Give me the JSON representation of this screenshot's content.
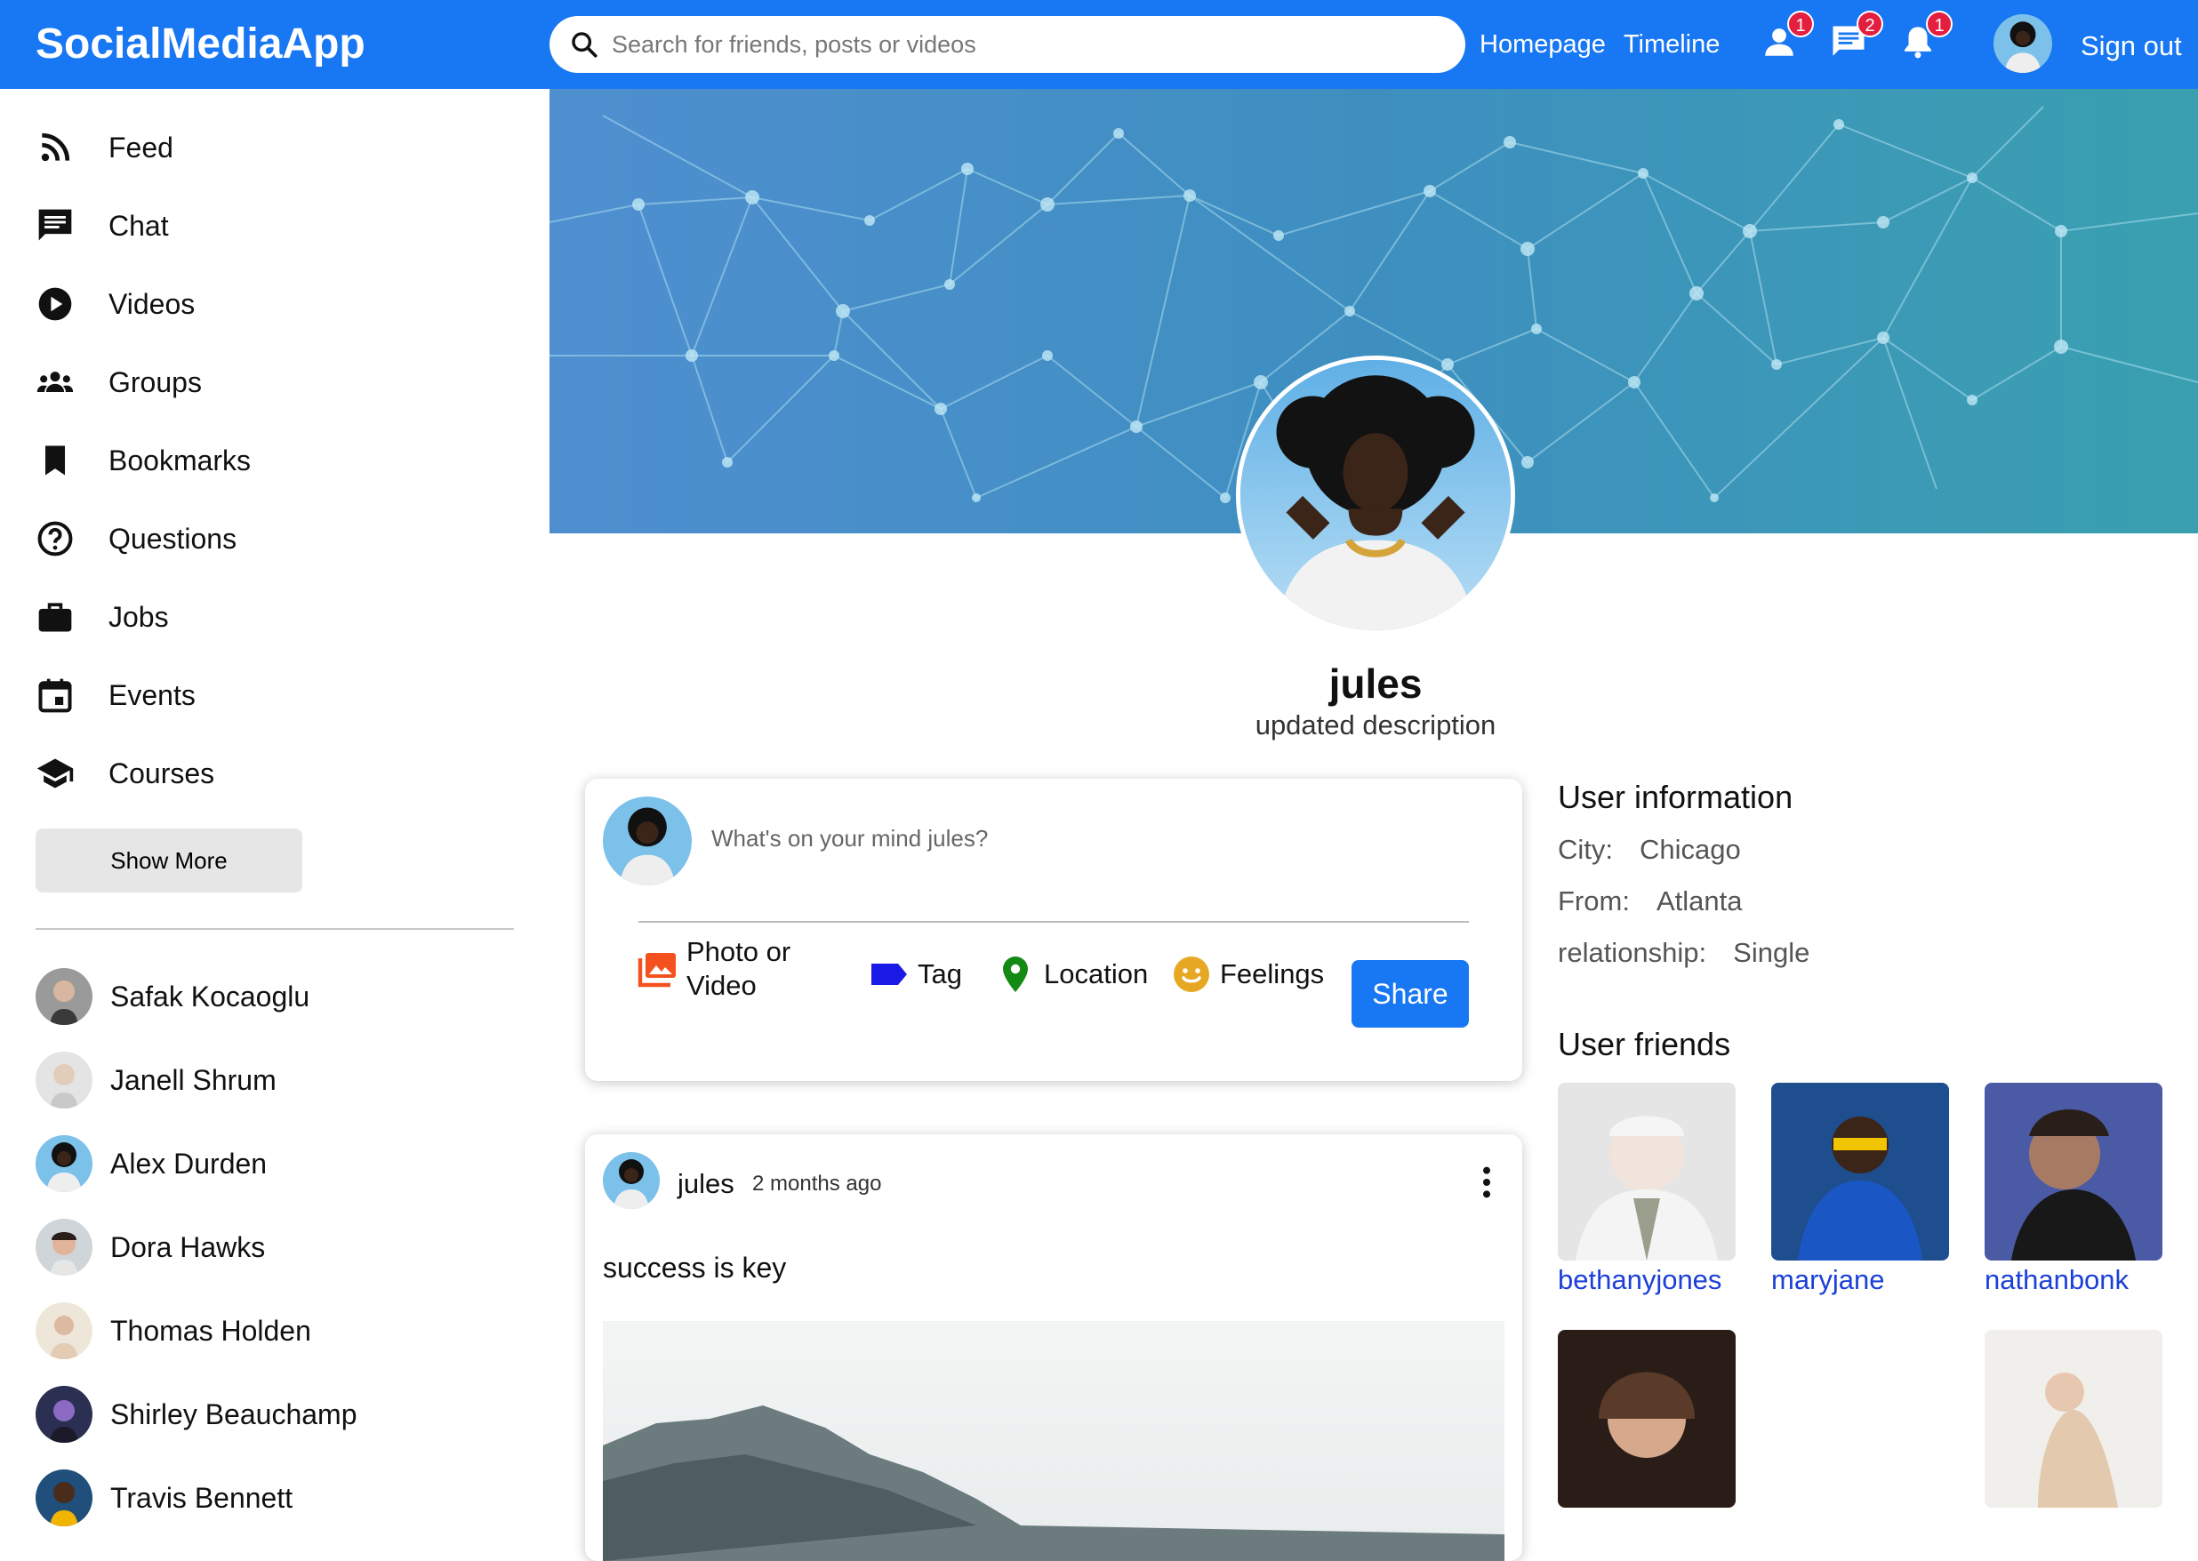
{
  "app": {
    "logo": "SocialMediaApp"
  },
  "topbar": {
    "search_placeholder": "Search for friends, posts or videos",
    "links": [
      "Homepage",
      "Timeline"
    ],
    "badges": {
      "friend_requests": "1",
      "messages": "2",
      "notifications": "1"
    },
    "sign_out": "Sign out"
  },
  "sidebar": {
    "items": [
      {
        "label": "Feed",
        "icon": "rss-feed-icon"
      },
      {
        "label": "Chat",
        "icon": "chat-icon"
      },
      {
        "label": "Videos",
        "icon": "play-circle-icon"
      },
      {
        "label": "Groups",
        "icon": "groups-icon"
      },
      {
        "label": "Bookmarks",
        "icon": "bookmark-icon"
      },
      {
        "label": "Questions",
        "icon": "help-circle-icon"
      },
      {
        "label": "Jobs",
        "icon": "briefcase-icon"
      },
      {
        "label": "Events",
        "icon": "calendar-icon"
      },
      {
        "label": "Courses",
        "icon": "school-icon"
      }
    ],
    "show_more": "Show More",
    "friends": [
      "Safak Kocaoglu",
      "Janell Shrum",
      "Alex Durden",
      "Dora Hawks",
      "Thomas Holden",
      "Shirley Beauchamp",
      "Travis Bennett"
    ]
  },
  "profile": {
    "name": "jules",
    "description": "updated description"
  },
  "share": {
    "placeholder": "What's on your mind jules?",
    "options": [
      "Photo or Video",
      "Tag",
      "Location",
      "Feelings"
    ],
    "button": "Share"
  },
  "post": {
    "user": "jules",
    "time": "2 months ago",
    "text": "success is key"
  },
  "user_info": {
    "title": "User information",
    "rows": [
      {
        "key": "City:",
        "value": "Chicago"
      },
      {
        "key": "From:",
        "value": "Atlanta"
      },
      {
        "key": "relationship:",
        "value": "Single"
      }
    ]
  },
  "user_friends": {
    "title": "User friends",
    "friends": [
      "bethanyjones",
      "maryjane",
      "nathanbonk",
      "",
      "",
      ""
    ]
  },
  "colors": {
    "brand": "#1877f2",
    "badge": "#e41e3f",
    "link": "#1b3fd8"
  }
}
